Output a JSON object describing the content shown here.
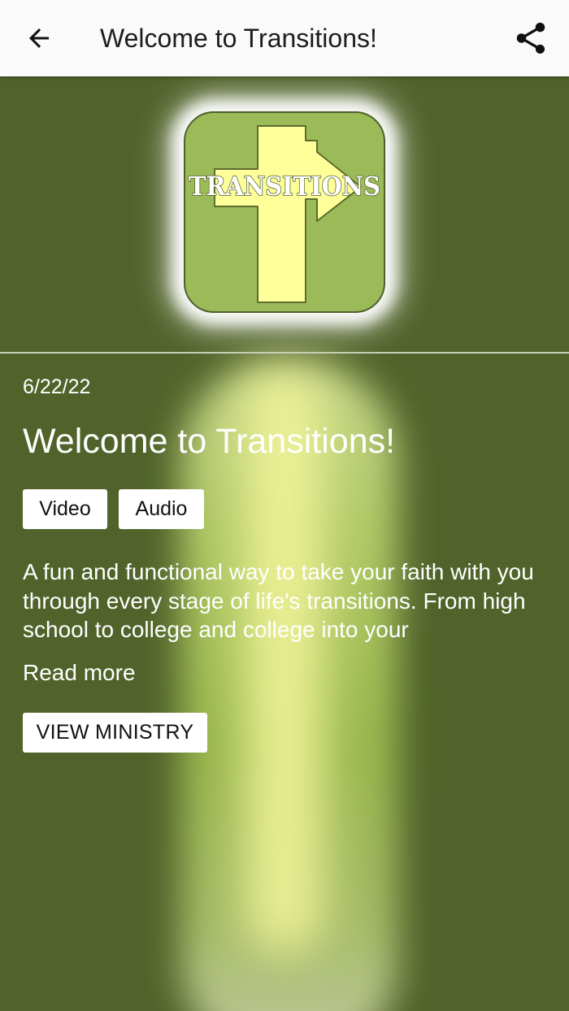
{
  "appbar": {
    "title": "Welcome to Transitions!",
    "back_icon": "arrow-left-icon",
    "share_icon": "share-icon"
  },
  "logo": {
    "text": "TRANSITIONS",
    "background_color": "#9bbb59",
    "cross_color": "#ffff99"
  },
  "post": {
    "date": "6/22/22",
    "title": "Welcome to Transitions!",
    "tags": [
      "Video",
      "Audio"
    ],
    "description": "A fun and functional way to take your faith with you through every stage of life's transitions. From high school to college and college into your",
    "read_more_label": "Read more",
    "view_ministry_label": "VIEW MINISTRY"
  },
  "colors": {
    "page_background": "#51632a",
    "appbar_background": "#fafafa",
    "text_on_background": "#ffffff"
  }
}
